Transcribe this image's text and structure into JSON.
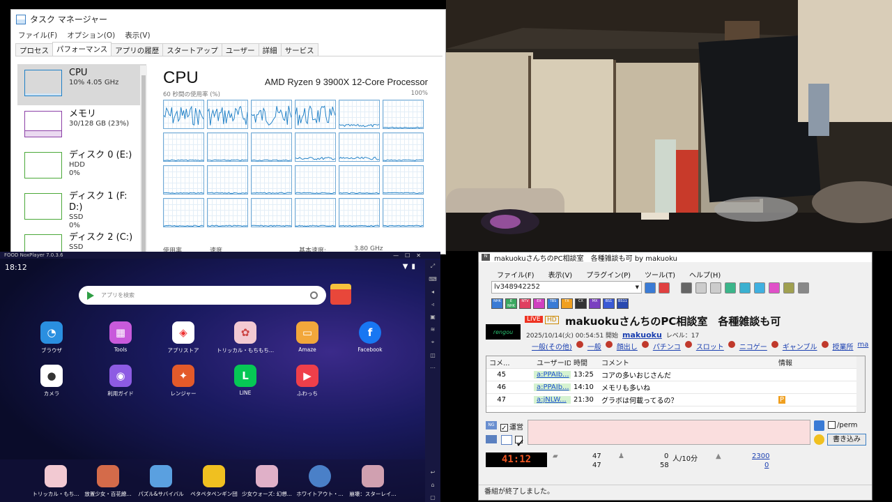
{
  "taskmgr": {
    "title": "タスク マネージャー",
    "menu": [
      "ファイル(F)",
      "オプション(O)",
      "表示(V)"
    ],
    "tabs": [
      "プロセス",
      "パフォーマンス",
      "アプリの履歴",
      "スタートアップ",
      "ユーザー",
      "詳細",
      "サービス"
    ],
    "active_tab": "パフォーマンス",
    "sidebar": [
      {
        "name": "CPU",
        "l1": "10%  4.05 GHz",
        "l2": "",
        "l3": "",
        "color": "#1e7fc6"
      },
      {
        "name": "メモリ",
        "l1": "30/128 GB (23%)",
        "l2": "",
        "l3": "",
        "color": "#8b3fa6"
      },
      {
        "name": "ディスク 0 (E:)",
        "l1": "HDD",
        "l2": "0%",
        "l3": "",
        "color": "#4aa838"
      },
      {
        "name": "ディスク 1 (F: D:)",
        "l1": "SSD",
        "l2": "0%",
        "l3": "",
        "color": "#4aa838"
      },
      {
        "name": "ディスク 2 (C:)",
        "l1": "SSD",
        "l2": "",
        "l3": "",
        "color": "#4aa838"
      }
    ],
    "heading": "CPU",
    "processor": "AMD Ryzen 9 3900X 12-Core Processor",
    "graph_label": "60 秒間の使用率 (%)",
    "graph_max": "100%",
    "bottom": [
      "使用率",
      "速度",
      "基本速度:",
      "3.80 GHz"
    ]
  },
  "emulator": {
    "title": "FOOD NoxPlayer 7.0.3.6",
    "time": "18:12",
    "search_placeholder": "アプリを検索",
    "apps": [
      {
        "label": "ブラウザ",
        "color": "#2a8fe0",
        "glyph": "◔"
      },
      {
        "label": "Tools",
        "color": "#c85adb",
        "glyph": "▦"
      },
      {
        "label": "アプリストア",
        "color": "#ffffff",
        "glyph": "◈"
      },
      {
        "label": "トリッカル・もちもち...",
        "color": "#f2c9d2",
        "glyph": "✿"
      },
      {
        "label": "Amaze",
        "color": "#f2a73b",
        "glyph": "▭"
      },
      {
        "label": "Facebook",
        "color": "#1877f2",
        "glyph": "f"
      },
      {
        "label": "カメラ",
        "color": "#ffffff",
        "glyph": "●"
      },
      {
        "label": "利用ガイド",
        "color": "#8d5be3",
        "glyph": "◉"
      },
      {
        "label": "レンジャー",
        "color": "#e35a2a",
        "glyph": "✦"
      },
      {
        "label": "LINE",
        "color": "#06c755",
        "glyph": "L"
      },
      {
        "label": "ふわっち",
        "color": "#ef3f4a",
        "glyph": "▶"
      }
    ],
    "dock": [
      {
        "label": "トリッカル・もち...",
        "color": "#f2c9d2"
      },
      {
        "label": "放置少女・百花繚...",
        "color": "#d46b4a"
      },
      {
        "label": "パズル&サバイバル",
        "color": "#5aa0e0"
      },
      {
        "label": "ペタペタペンギン団",
        "color": "#f0c020"
      },
      {
        "label": "少女ウォーズ: 幻想...",
        "color": "#e0b0c8"
      },
      {
        "label": "ホワイトアウト・...",
        "color": "#4a80c8"
      },
      {
        "label": "崩壊：スターレイ...",
        "color": "#d0a0b0"
      }
    ]
  },
  "nico": {
    "window_title": "makuokuさんちのPC相談室　各種雑談も可 by makuoku",
    "menu": [
      "ファイル(F)",
      "表示(V)",
      "プラグイン(P)",
      "ツール(T)",
      "ヘルプ(H)"
    ],
    "lv": "lv348942252",
    "channels": [
      "NHK",
      "E NHK",
      "NTV",
      "EX",
      "TBS",
      "TX",
      "CX",
      "MX",
      "BS1",
      "BS11"
    ],
    "live": "LIVE",
    "hd": "HD",
    "logo": "rengou",
    "stream_title": "makuokuさんちのPC相談室　各種雑談も可",
    "start": "2025/10/14(火) 00:54:51 開始",
    "user": "makuoku",
    "level": "レベル：17",
    "categories": [
      "一般(その他)",
      "一般",
      "顔出し",
      "パチンコ",
      "スロット",
      "ニコゲー",
      "ギャンブル",
      "授業所",
      "ma"
    ],
    "headers": [
      "コメ...",
      "",
      "ユーザーID",
      "時間",
      "コメント",
      "情報"
    ],
    "rows": [
      {
        "no": "45",
        "uid": "a:PPAIb...",
        "time": "13:25",
        "text": "コアの多いおじさんだ",
        "info": ""
      },
      {
        "no": "46",
        "uid": "a:PPAIb...",
        "time": "14:10",
        "text": "メモリも多いね",
        "info": ""
      },
      {
        "no": "47",
        "uid": "a:jNLW...",
        "time": "21:30",
        "text": "グラボは何載ってるの？",
        "info": "P"
      }
    ],
    "ng": "NG",
    "unei": "運営",
    "perm": "/perm",
    "write": "書き込み",
    "timer": "41:12",
    "stats": {
      "c1": "47",
      "c2": "47",
      "v1": "0",
      "v1unit": "人/10分",
      "v2": "58",
      "pts": "2300",
      "pts2": "0"
    },
    "status": "番組が終了しました。"
  }
}
